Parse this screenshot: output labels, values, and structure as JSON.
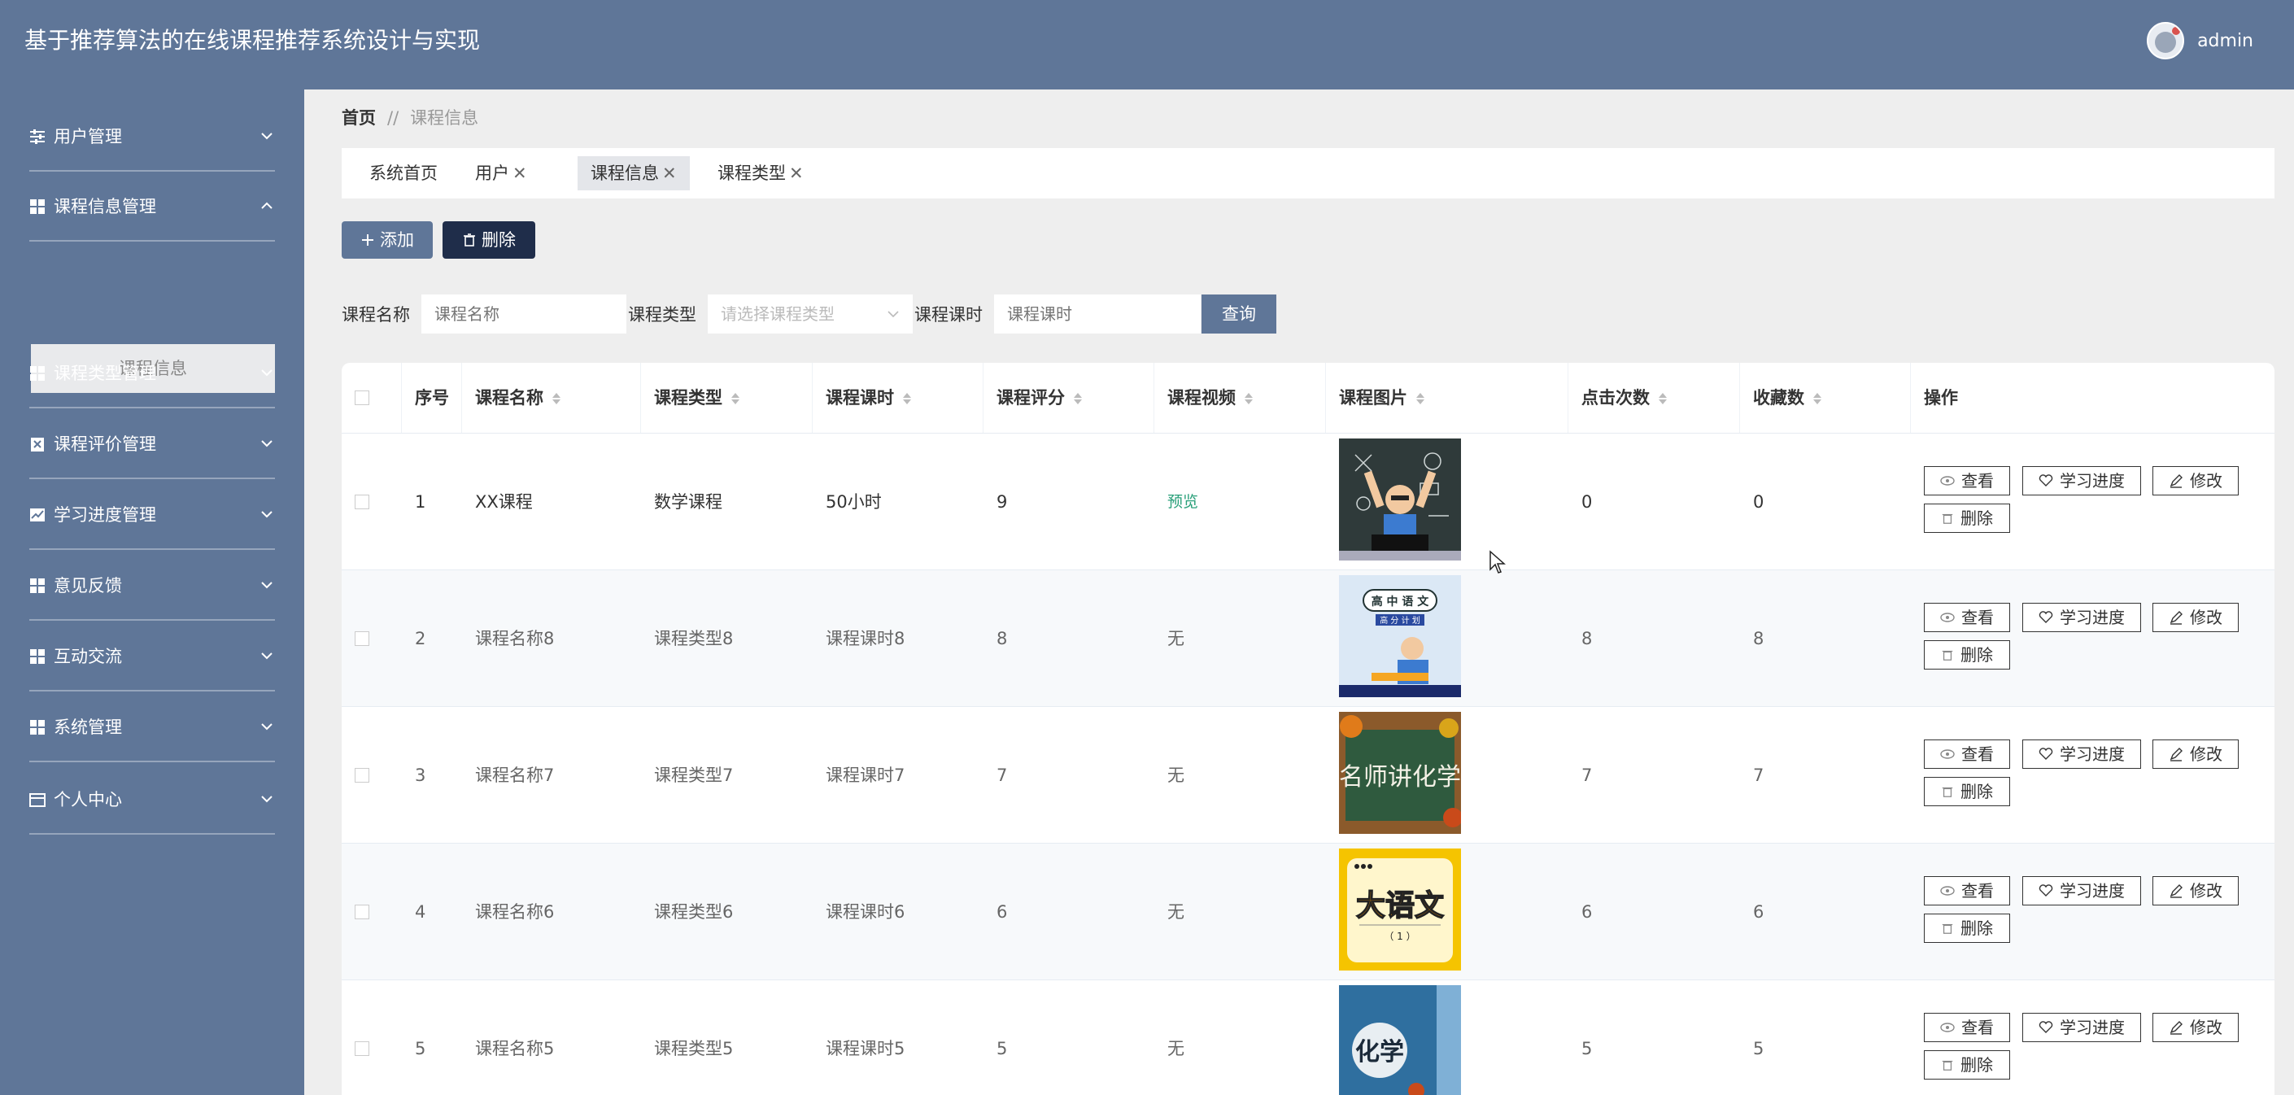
{
  "header": {
    "title": "基于推荐算法的在线课程推荐系统设计与实现",
    "username": "admin"
  },
  "sidebar": {
    "items": [
      {
        "label": "用户管理",
        "icon": "sliders-icon",
        "expanded": false
      },
      {
        "label": "课程信息管理",
        "icon": "grid-icon",
        "expanded": true
      },
      {
        "label": "课程类型管理",
        "icon": "grid-icon",
        "expanded": false
      },
      {
        "label": "课程评价管理",
        "icon": "clipboard-icon",
        "expanded": false
      },
      {
        "label": "学习进度管理",
        "icon": "chart-icon",
        "expanded": false
      },
      {
        "label": "意见反馈",
        "icon": "grid-icon",
        "expanded": false
      },
      {
        "label": "互动交流",
        "icon": "grid-icon",
        "expanded": false
      },
      {
        "label": "系统管理",
        "icon": "grid-icon",
        "expanded": false
      },
      {
        "label": "个人中心",
        "icon": "calendar-icon",
        "expanded": false
      }
    ],
    "submenu_label": "课程信息"
  },
  "breadcrumb": {
    "home": "首页",
    "sep": "//",
    "current": "课程信息"
  },
  "tabs": [
    {
      "label": "系统首页",
      "closable": false
    },
    {
      "label": "用户",
      "closable": true
    },
    {
      "label": "课程信息",
      "closable": true,
      "active": true
    },
    {
      "label": "课程类型",
      "closable": true
    }
  ],
  "tab_close": "✕",
  "actions": {
    "add": "添加",
    "delete": "删除"
  },
  "search": {
    "name_label": "课程名称",
    "name_placeholder": "课程名称",
    "type_label": "课程类型",
    "type_placeholder": "请选择课程类型",
    "hours_label": "课程课时",
    "hours_placeholder": "课程课时",
    "query": "查询"
  },
  "table": {
    "columns": [
      "序号",
      "课程名称",
      "课程类型",
      "课程课时",
      "课程评分",
      "课程视频",
      "课程图片",
      "点击次数",
      "收藏数",
      "操作"
    ],
    "rows": [
      {
        "idx": "1",
        "name": "XX课程",
        "type": "数学课程",
        "hours": "50小时",
        "score": "9",
        "video": "预览",
        "clicks": "0",
        "favs": "0"
      },
      {
        "idx": "2",
        "name": "课程名称8",
        "type": "课程类型8",
        "hours": "课程课时8",
        "score": "8",
        "video": "无",
        "clicks": "8",
        "favs": "8"
      },
      {
        "idx": "3",
        "name": "课程名称7",
        "type": "课程类型7",
        "hours": "课程课时7",
        "score": "7",
        "video": "无",
        "clicks": "7",
        "favs": "7"
      },
      {
        "idx": "4",
        "name": "课程名称6",
        "type": "课程类型6",
        "hours": "课程课时6",
        "score": "6",
        "video": "无",
        "clicks": "6",
        "favs": "6"
      },
      {
        "idx": "5",
        "name": "课程名称5",
        "type": "课程类型5",
        "hours": "课程课时5",
        "score": "5",
        "video": "无",
        "clicks": "5",
        "favs": "5"
      }
    ],
    "ops": {
      "view": "查看",
      "progress": "学习进度",
      "edit": "修改",
      "delete": "删除"
    },
    "thumb_texts": {
      "t2_title": "高 中 语 文",
      "t2_sub": "高 分 计 划",
      "t3": "名师讲化学",
      "t4_main": "大语文",
      "t4_sub": "（ 1 ）",
      "t5": "化学"
    }
  },
  "colors": {
    "primary": "#5f7698",
    "dark": "#1f2d4a",
    "link": "#2aa07a"
  }
}
